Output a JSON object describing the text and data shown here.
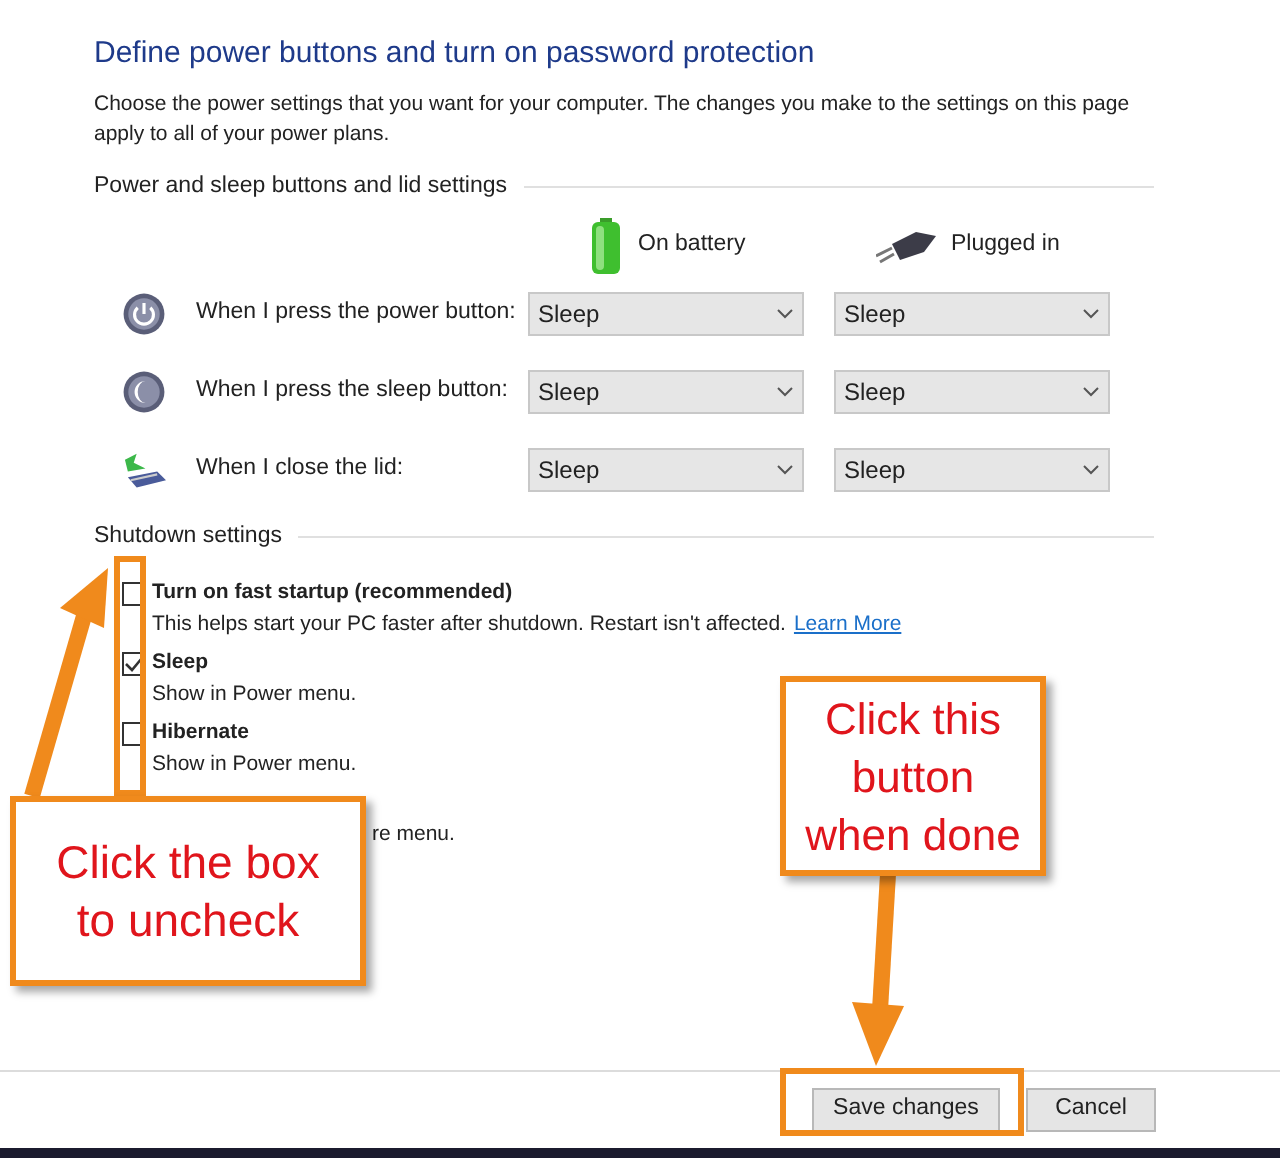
{
  "title": "Define power buttons and turn on password protection",
  "description": "Choose the power settings that you want for your computer. The changes you make to the settings on this page apply to all of your power plans.",
  "power_section": {
    "heading": "Power and sleep buttons and lid settings",
    "columns": [
      {
        "kind": "battery",
        "label": "On battery"
      },
      {
        "kind": "plug",
        "label": "Plugged in"
      }
    ],
    "rows": [
      {
        "kind": "power",
        "label": "When I press the power button:",
        "values": [
          "Sleep",
          "Sleep"
        ]
      },
      {
        "kind": "sleep",
        "label": "When I press the sleep button:",
        "values": [
          "Sleep",
          "Sleep"
        ]
      },
      {
        "kind": "lid",
        "label": "When I close the lid:",
        "values": [
          "Sleep",
          "Sleep"
        ]
      }
    ]
  },
  "shutdown_section": {
    "heading": "Shutdown settings",
    "items": [
      {
        "kind": "checkbox",
        "label": "Turn on fast startup (recommended)",
        "checked": false,
        "description": "This helps start your PC faster after shutdown. Restart isn't affected.",
        "link": "Learn More"
      },
      {
        "kind": "checkbox",
        "label": "Sleep",
        "checked": true,
        "description": "Show in Power menu."
      },
      {
        "kind": "checkbox",
        "label": "Hibernate",
        "checked": false,
        "description": "Show in Power menu."
      },
      {
        "kind": "partial",
        "description": "re menu."
      }
    ]
  },
  "buttons": [
    {
      "label": "Save changes"
    },
    {
      "label": "Cancel"
    }
  ],
  "annotations": [
    {
      "text": "Click the box to uncheck"
    },
    {
      "text": "Click this button when done"
    }
  ]
}
